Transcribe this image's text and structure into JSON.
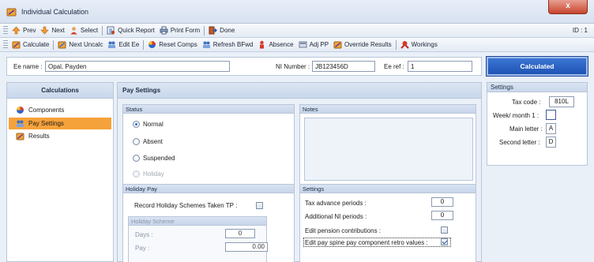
{
  "window": {
    "title": "Individual Calculation",
    "close_glyph": "x"
  },
  "toolbar1": {
    "items": [
      {
        "label": "Prev",
        "icon": "arrow-up-icon"
      },
      {
        "label": "Next",
        "icon": "arrow-down-icon"
      },
      {
        "label": "Select",
        "icon": "select-person-icon"
      },
      {
        "label": "Quick Report",
        "icon": "quick-report-icon"
      },
      {
        "label": "Print Form",
        "icon": "print-form-icon"
      },
      {
        "label": "Done",
        "icon": "done-icon"
      }
    ],
    "id_label": "ID : 1"
  },
  "toolbar2": {
    "items": [
      {
        "label": "Calculate",
        "icon": "calculate-icon"
      },
      {
        "label": "Next Uncalc",
        "icon": "next-uncalc-icon"
      },
      {
        "label": "Edit Ee",
        "icon": "edit-ee-icon"
      },
      {
        "label": "Reset Comps",
        "icon": "reset-comps-icon"
      },
      {
        "label": "Refresh BFwd",
        "icon": "refresh-bfwd-icon"
      },
      {
        "label": "Absence",
        "icon": "absence-icon"
      },
      {
        "label": "Adj PP",
        "icon": "adj-pp-icon"
      },
      {
        "label": "Override Results",
        "icon": "override-results-icon"
      },
      {
        "label": "Workings",
        "icon": "workings-icon"
      }
    ]
  },
  "employee": {
    "name_label": "Ee name :",
    "name_value": "Opal, Payden",
    "ni_label": "NI Number :",
    "ni_value": "JB123456D",
    "ref_label": "Ee ref :",
    "ref_value": "1"
  },
  "status_button": "Calculated",
  "settings_panel": {
    "title": "Settings",
    "tax_code_label": "Tax code :",
    "tax_code_value": "810L",
    "week_month_label": "Week/ month 1 :",
    "main_letter_label": "Main letter :",
    "main_letter_value": "A",
    "second_letter_label": "Second letter :",
    "second_letter_value": "D"
  },
  "calculations": {
    "title": "Calculations",
    "items": [
      {
        "label": "Components",
        "icon": "components-icon",
        "active": false
      },
      {
        "label": "Pay Settings",
        "icon": "pay-settings-icon",
        "active": true
      },
      {
        "label": "Results",
        "icon": "results-icon",
        "active": false
      }
    ]
  },
  "pay_settings": {
    "title": "Pay Settings",
    "status": {
      "title": "Status",
      "options": [
        "Normal",
        "Absent",
        "Suspended",
        "Holiday"
      ],
      "selected": "Normal"
    },
    "notes": {
      "title": "Notes",
      "value": ""
    },
    "holiday_pay": {
      "title": "Holiday Pay",
      "record_label": "Record Holiday Schemes Taken TP :",
      "scheme_title": "Holiday Scheme",
      "days_label": "Days :",
      "days_value": "0",
      "pay_label": "Pay :",
      "pay_value": "0.00"
    },
    "settings": {
      "title": "Settings",
      "tax_advance_label": "Tax advance periods :",
      "tax_advance_value": "0",
      "additional_ni_label": "Additional NI periods :",
      "additional_ni_value": "0",
      "edit_pension_label": "Edit pension contributions :",
      "edit_spine_label": "Edit pay spine pay component retro values :"
    }
  },
  "colors": {
    "accent_blue": "#1f54b4",
    "nav_active": "#f6a23a",
    "panel_header": "#c9d7eb",
    "close_red": "#c7442e"
  }
}
